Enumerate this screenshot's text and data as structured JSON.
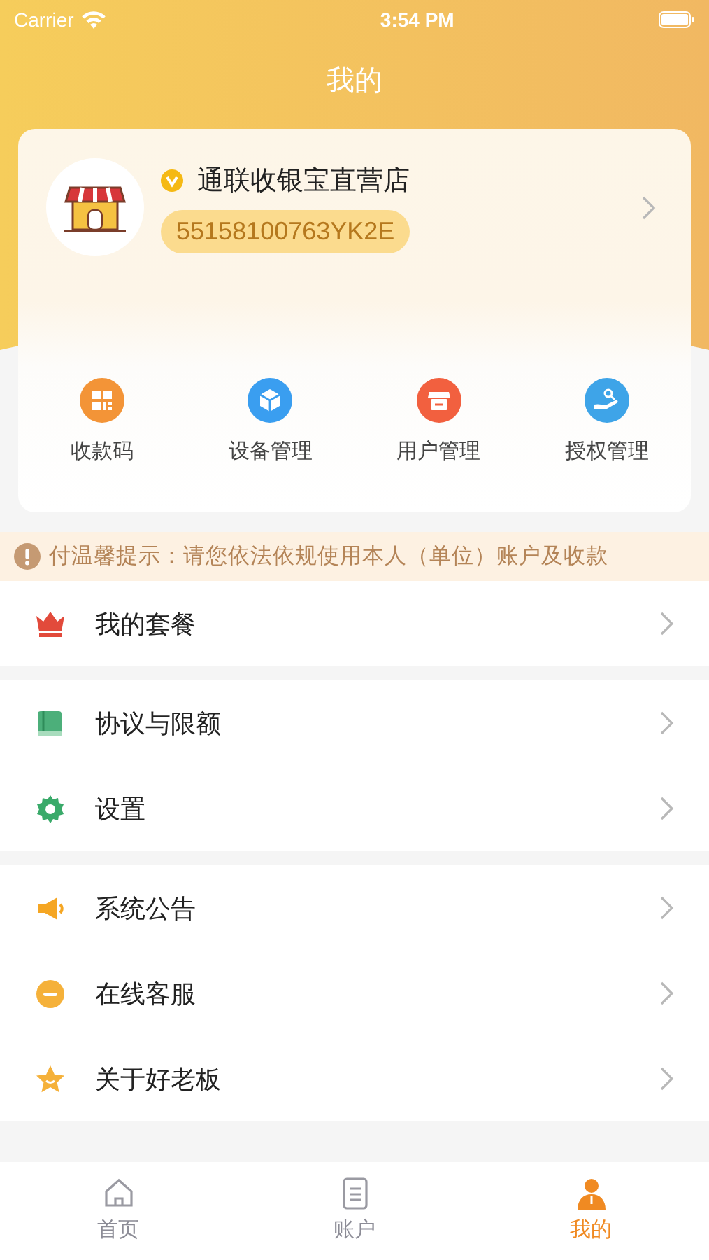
{
  "status_bar": {
    "carrier": "Carrier",
    "time": "3:54 PM"
  },
  "header": {
    "title": "我的"
  },
  "profile": {
    "store_name": "通联收银宝直营店",
    "verified": true,
    "merchant_id": "55158100763YK2E"
  },
  "quick_actions": [
    {
      "label": "收款码",
      "kind": "qrcode",
      "color": "#f39437"
    },
    {
      "label": "设备管理",
      "kind": "cube",
      "color": "#3a9ef0"
    },
    {
      "label": "用户管理",
      "kind": "store",
      "color": "#f2603f"
    },
    {
      "label": "授权管理",
      "kind": "hand",
      "color": "#3ea4e8"
    }
  ],
  "notice": {
    "text": "付温馨提示：请您依法依规使用本人（单位）账户及收款"
  },
  "menu_groups": [
    [
      {
        "label": "我的套餐",
        "kind": "crown"
      }
    ],
    [
      {
        "label": "协议与限额",
        "kind": "book"
      },
      {
        "label": "设置",
        "kind": "gear"
      }
    ],
    [
      {
        "label": "系统公告",
        "kind": "megaphone"
      },
      {
        "label": "在线客服",
        "kind": "chat"
      },
      {
        "label": "关于好老板",
        "kind": "star"
      }
    ]
  ],
  "tabs": [
    {
      "label": "首页",
      "kind": "home",
      "selected": false
    },
    {
      "label": "账户",
      "kind": "document",
      "selected": false
    },
    {
      "label": "我的",
      "kind": "person",
      "selected": true
    }
  ]
}
